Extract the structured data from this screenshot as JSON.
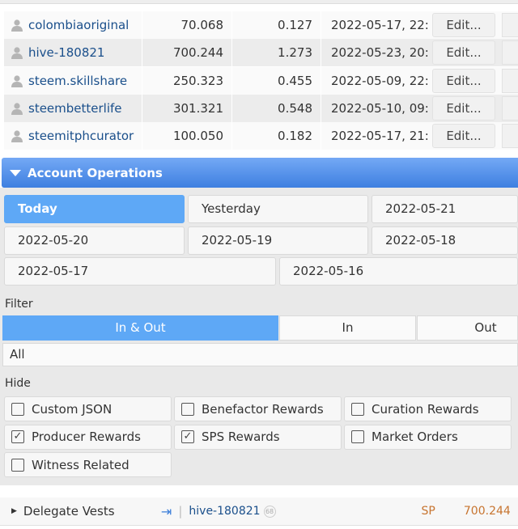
{
  "delegations": [
    {
      "account": "colombiaoriginal",
      "vests": "70.068",
      "sp": "0.127",
      "date": "2022-05-17, 22:",
      "edit_label": "Edit..."
    },
    {
      "account": "hive-180821",
      "vests": "700.244",
      "sp": "1.273",
      "date": "2022-05-23, 20:",
      "edit_label": "Edit..."
    },
    {
      "account": "steem.skillshare",
      "vests": "250.323",
      "sp": "0.455",
      "date": "2022-05-09, 22:",
      "edit_label": "Edit..."
    },
    {
      "account": "steembetterlife",
      "vests": "301.321",
      "sp": "0.548",
      "date": "2022-05-10, 09:",
      "edit_label": "Edit..."
    },
    {
      "account": "steemitphcurator",
      "vests": "100.050",
      "sp": "0.182",
      "date": "2022-05-17, 21:",
      "edit_label": "Edit..."
    }
  ],
  "section": {
    "title": "Account Operations",
    "icon": "triangle-down-icon"
  },
  "dates": [
    "Today",
    "Yesterday",
    "2022-05-21",
    "2022-05-20",
    "2022-05-19",
    "2022-05-18",
    "2022-05-17",
    "2022-05-16"
  ],
  "filter": {
    "label": "Filter",
    "options": [
      "In & Out",
      "In",
      "Out"
    ],
    "selected": "In & Out",
    "value": "All"
  },
  "hide": {
    "label": "Hide",
    "options": [
      {
        "label": "Custom JSON",
        "checked": false
      },
      {
        "label": "Benefactor Rewards",
        "checked": false
      },
      {
        "label": "Curation Rewards",
        "checked": false
      },
      {
        "label": "Producer Rewards",
        "checked": true
      },
      {
        "label": "SPS Rewards",
        "checked": true
      },
      {
        "label": "Market Orders",
        "checked": false
      },
      {
        "label": "Witness Related",
        "checked": false
      }
    ]
  },
  "operation": {
    "type": "Delegate Vests",
    "direction_icon": "sign-in-icon",
    "account": "hive-180821",
    "reputation": "68",
    "unit": "SP",
    "amount": "700.244"
  },
  "colors": {
    "accent": "#5ea8f6",
    "link": "#1a4f8b",
    "amount": "#c7742f"
  }
}
